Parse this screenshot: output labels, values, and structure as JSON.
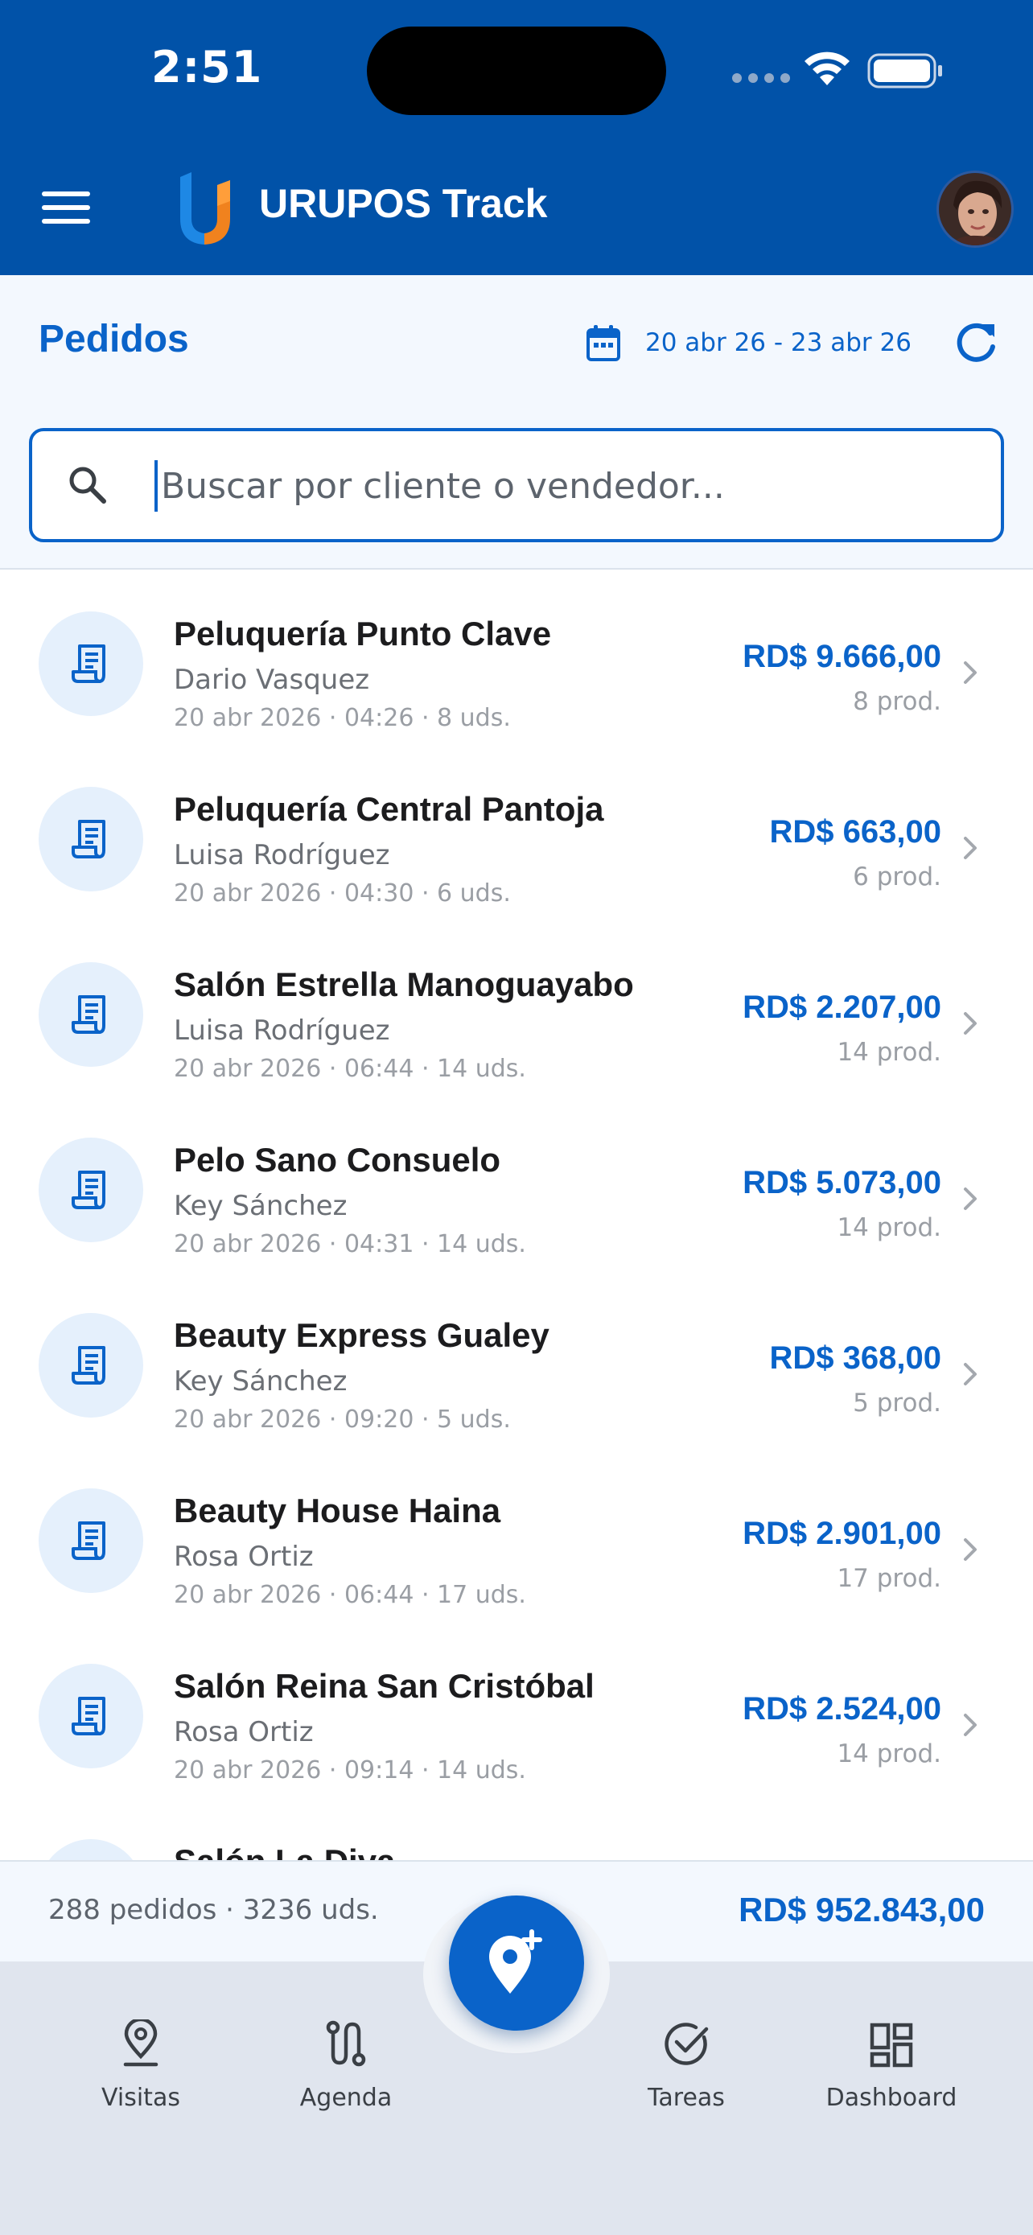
{
  "status_bar": {
    "time": "2:51"
  },
  "app": {
    "title": "URUPOS Track"
  },
  "toolbar": {
    "title": "Pedidos",
    "date_range": "20 abr 26 - 23 abr 26"
  },
  "search": {
    "placeholder": "Buscar por cliente o vendedor..."
  },
  "orders": [
    {
      "name": "Peluquería Punto Clave",
      "seller": "Dario Vasquez",
      "meta": "20 abr 2026 · 04:26 · 8 uds.",
      "amount": "RD$ 9.666,00",
      "products": "8 prod."
    },
    {
      "name": "Peluquería Central Pantoja",
      "seller": "Luisa Rodríguez",
      "meta": "20 abr 2026 · 04:30 · 6 uds.",
      "amount": "RD$ 663,00",
      "products": "6 prod."
    },
    {
      "name": "Salón Estrella Manoguayabo",
      "seller": "Luisa Rodríguez",
      "meta": "20 abr 2026 · 06:44 · 14 uds.",
      "amount": "RD$ 2.207,00",
      "products": "14 prod."
    },
    {
      "name": "Pelo Sano Consuelo",
      "seller": "Key Sánchez",
      "meta": "20 abr 2026 · 04:31 · 14 uds.",
      "amount": "RD$ 5.073,00",
      "products": "14 prod."
    },
    {
      "name": "Beauty Express Gualey",
      "seller": "Key Sánchez",
      "meta": "20 abr 2026 · 09:20 · 5 uds.",
      "amount": "RD$ 368,00",
      "products": "5 prod."
    },
    {
      "name": "Beauty House Haina",
      "seller": "Rosa Ortiz",
      "meta": "20 abr 2026 · 06:44 · 17 uds.",
      "amount": "RD$ 2.901,00",
      "products": "17 prod."
    },
    {
      "name": "Salón Reina San Cristóbal",
      "seller": "Rosa Ortiz",
      "meta": "20 abr 2026 · 09:14 · 14 uds.",
      "amount": "RD$ 2.524,00",
      "products": "14 prod."
    },
    {
      "name": "Salón La Diva",
      "seller": "",
      "meta": "",
      "amount": "",
      "products": ""
    }
  ],
  "footer": {
    "summary": "288 pedidos · 3236 uds.",
    "total": "RD$ 952.843,00"
  },
  "tabs": [
    {
      "label": "Visitas",
      "icon": "map-pin-icon"
    },
    {
      "label": "Agenda",
      "icon": "route-icon"
    },
    {
      "label": "Tareas",
      "icon": "check-circle-icon"
    },
    {
      "label": "Dashboard",
      "icon": "dashboard-icon"
    }
  ],
  "colors": {
    "header": "#0152a8",
    "accent": "#0a63c9",
    "toolbar_bg": "#f3f8fe",
    "tabbar_bg": "#e0e5ee",
    "icon_circle": "#e5f0fc"
  }
}
